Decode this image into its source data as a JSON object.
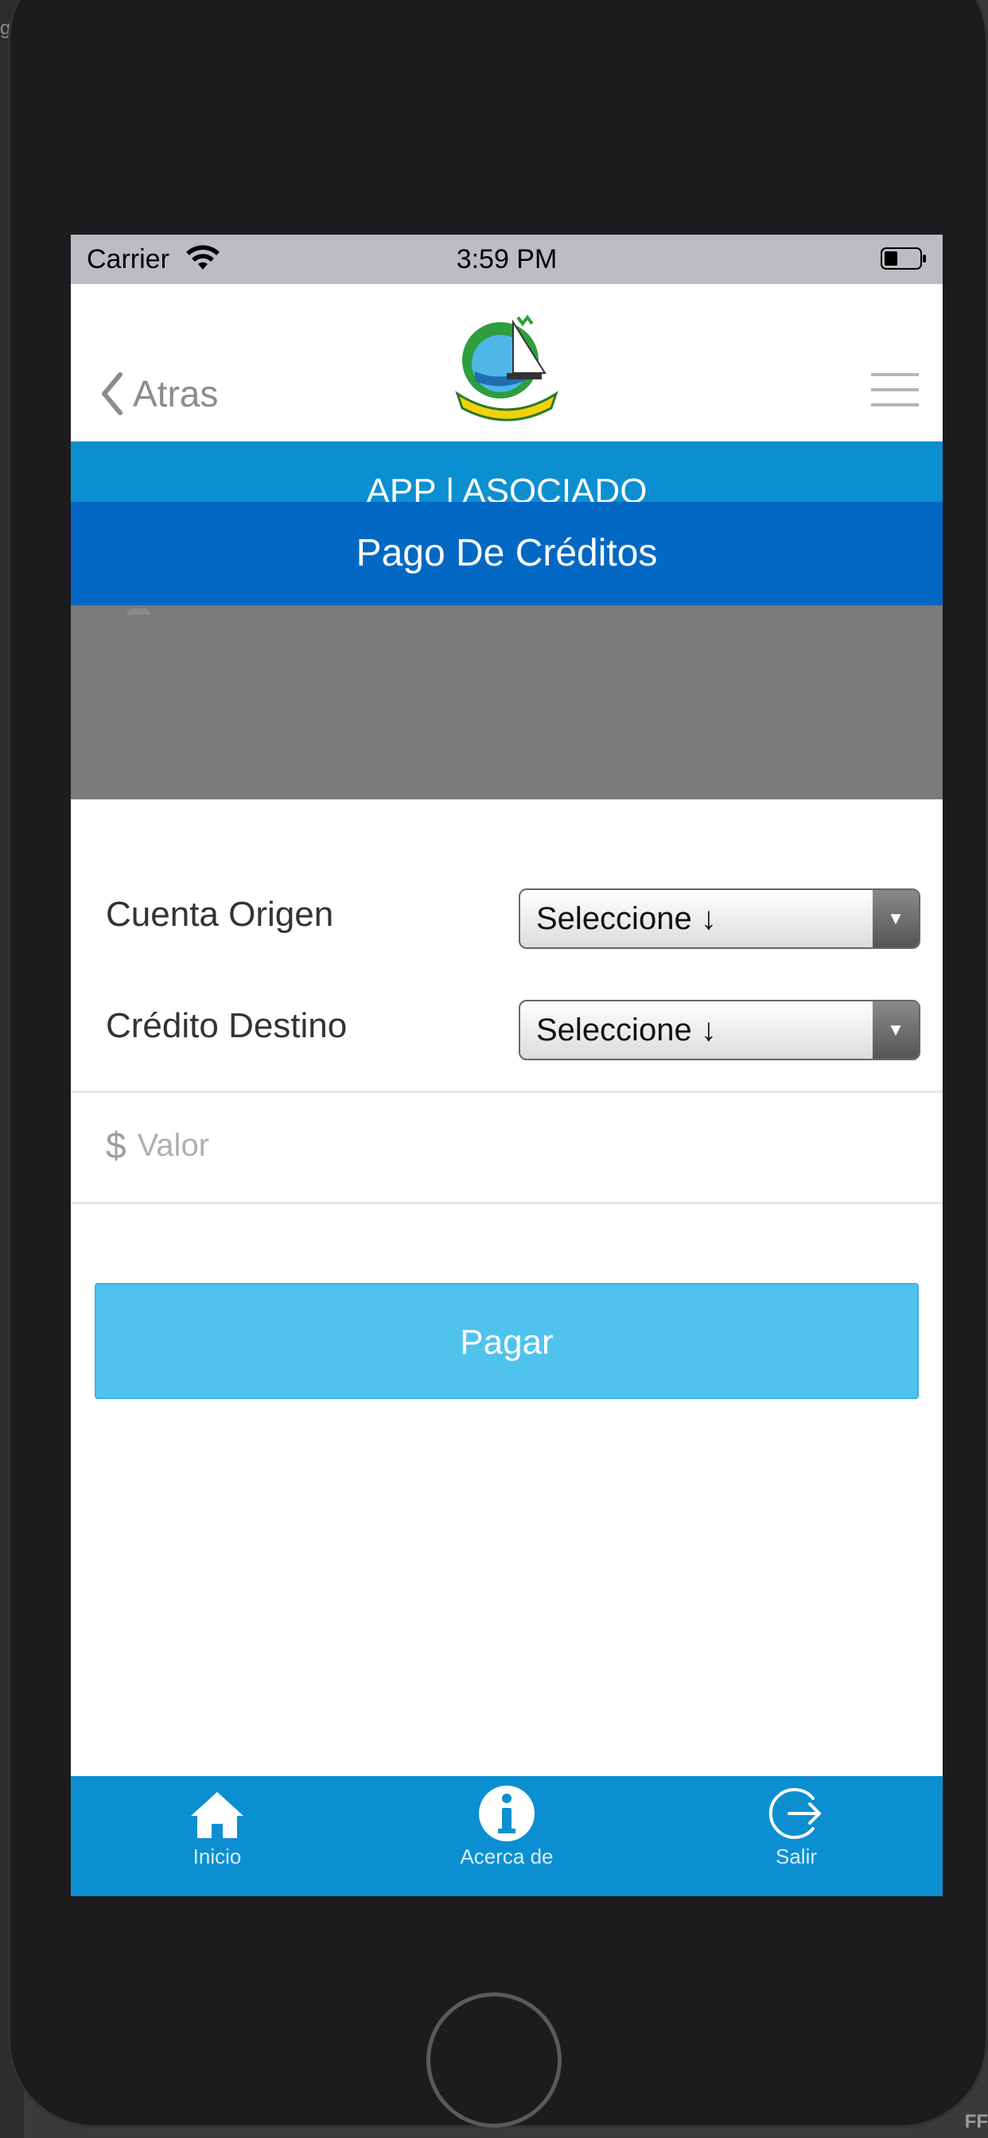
{
  "background": {
    "left_title_fragment": "g Ap",
    "corner_text": "FF"
  },
  "status_bar": {
    "carrier": "Carrier",
    "time": "3:59 PM"
  },
  "nav": {
    "back_label": "Atras"
  },
  "app_header": {
    "text": "APP | ASOCIADO"
  },
  "page_title": "Pago De Créditos",
  "form": {
    "origin_label": "Cuenta Origen",
    "origin_select_value": "Seleccione ↓",
    "dest_label": "Crédito Destino",
    "dest_select_value": "Seleccione ↓",
    "currency_symbol": "$",
    "amount_placeholder": "Valor",
    "submit_label": "Pagar"
  },
  "tabs": [
    {
      "label": "Inicio",
      "icon": "home-icon"
    },
    {
      "label": "Acerca de",
      "icon": "info-icon"
    },
    {
      "label": "Salir",
      "icon": "exit-icon"
    }
  ],
  "colors": {
    "primary_blue": "#0b8fd1",
    "title_blue": "#0368c4",
    "button_blue": "#4fc3ee",
    "overlay_gray": "#7b7b7b"
  }
}
